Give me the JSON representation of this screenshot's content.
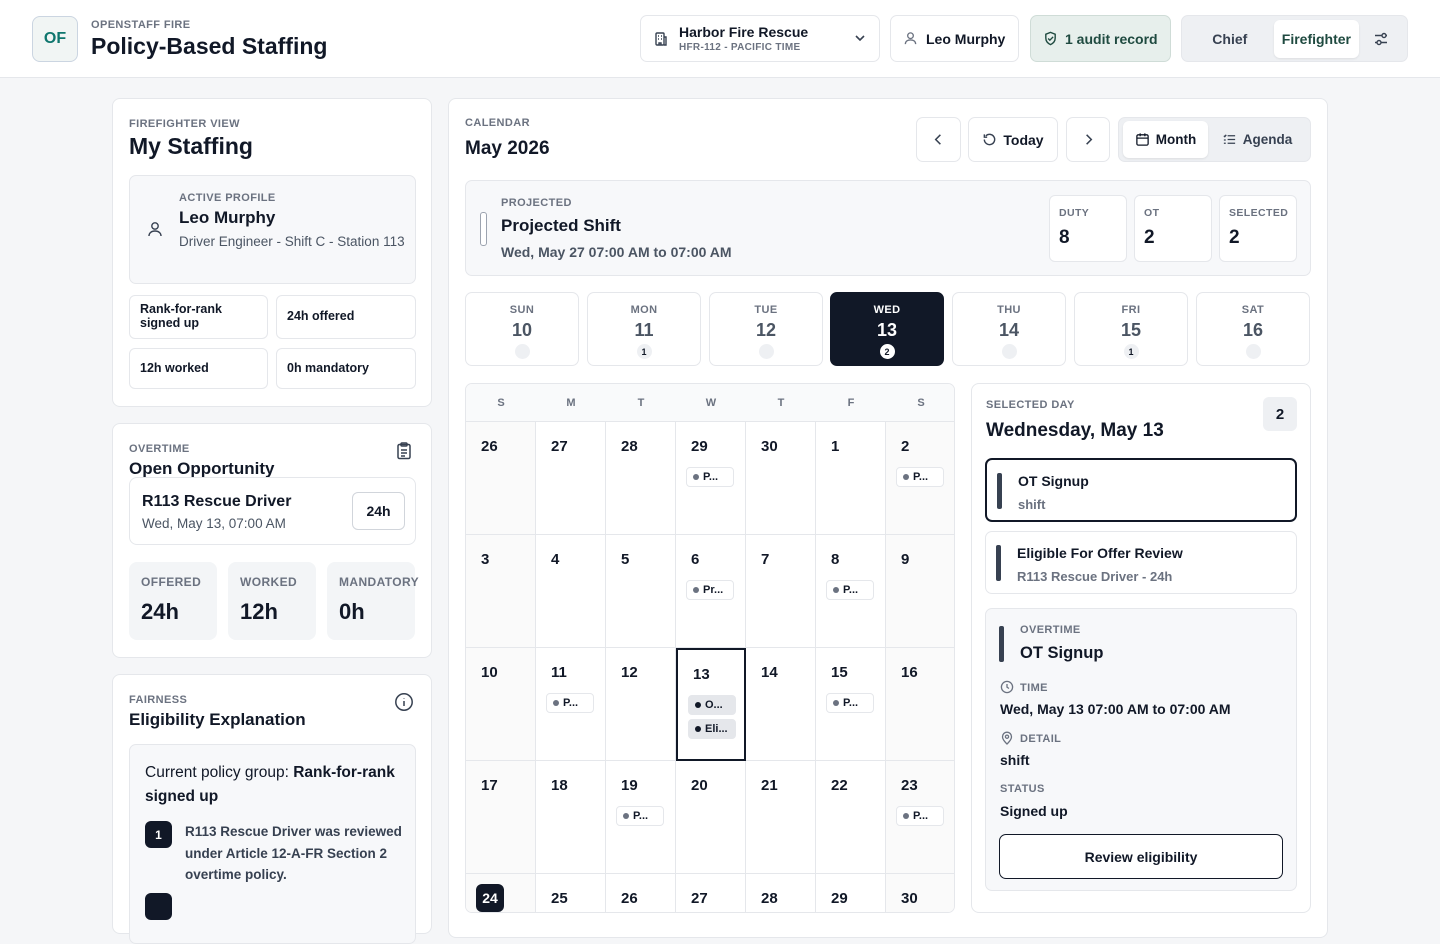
{
  "header": {
    "logo": "OF",
    "app_label": "OPENSTAFF FIRE",
    "title": "Policy-Based Staffing",
    "org": {
      "name": "Harbor Fire Rescue",
      "sub": "HFR-112 - PACIFIC TIME"
    },
    "user": "Leo Murphy",
    "audit": "1 audit record",
    "roles": [
      "Chief",
      "Firefighter"
    ],
    "active_role": "Firefighter"
  },
  "profile_card": {
    "label": "FIREFIGHTER VIEW",
    "title": "My Staffing",
    "active_label": "ACTIVE PROFILE",
    "name": "Leo Murphy",
    "detail": "Driver Engineer - Shift C - Station 113",
    "chips": [
      "Rank-for-rank signed up",
      "24h offered",
      "12h worked",
      "0h mandatory"
    ]
  },
  "overtime_card": {
    "label": "OVERTIME",
    "title": "Open Opportunity",
    "opp_title": "R113 Rescue Driver",
    "opp_time": "Wed, May 13, 07:00 AM",
    "opp_hours": "24h",
    "stats": [
      {
        "k": "OFFERED",
        "v": "24h"
      },
      {
        "k": "WORKED",
        "v": "12h"
      },
      {
        "k": "MANDATORY",
        "v": "0h"
      }
    ]
  },
  "fairness_card": {
    "label": "FAIRNESS",
    "title": "Eligibility Explanation",
    "policy_prefix": "Current policy group: ",
    "policy_group": "Rank-for-rank signed up",
    "steps": [
      {
        "n": "1",
        "text": "R113 Rescue Driver was reviewed under Article 12-A-FR Section 2 overtime policy."
      }
    ]
  },
  "calendar": {
    "label": "CALENDAR",
    "month": "May 2026",
    "today_label": "Today",
    "views": [
      "Month",
      "Agenda"
    ],
    "projected": {
      "label": "PROJECTED",
      "title": "Projected Shift",
      "time": "Wed, May 27 07:00 AM to 07:00 AM",
      "stats": [
        {
          "k": "DUTY",
          "v": "8"
        },
        {
          "k": "OT",
          "v": "2"
        },
        {
          "k": "SELECTED",
          "v": "2"
        }
      ]
    },
    "week": [
      {
        "d": "SUN",
        "n": "10",
        "c": ""
      },
      {
        "d": "MON",
        "n": "11",
        "c": "1"
      },
      {
        "d": "TUE",
        "n": "12",
        "c": ""
      },
      {
        "d": "WED",
        "n": "13",
        "c": "2"
      },
      {
        "d": "THU",
        "n": "14",
        "c": ""
      },
      {
        "d": "FRI",
        "n": "15",
        "c": "1"
      },
      {
        "d": "SAT",
        "n": "16",
        "c": ""
      }
    ],
    "weekday_heads": [
      "S",
      "M",
      "T",
      "W",
      "T",
      "F",
      "S"
    ],
    "days": [
      "26",
      "27",
      "28",
      "29",
      "30",
      "1",
      "2",
      "3",
      "4",
      "5",
      "6",
      "7",
      "8",
      "9",
      "10",
      "11",
      "12",
      "13",
      "14",
      "15",
      "16",
      "17",
      "18",
      "19",
      "20",
      "21",
      "22",
      "23",
      "24",
      "25",
      "26",
      "27",
      "28",
      "29",
      "30"
    ],
    "events": {
      "3": [
        "P..."
      ],
      "6": [
        "P..."
      ],
      "10": [
        "Pr..."
      ],
      "12": [
        "P..."
      ],
      "15": [
        "P..."
      ],
      "17": [
        "O...",
        "Eli..."
      ],
      "19": [
        "P..."
      ],
      "23": [
        "P..."
      ],
      "27": [
        "P..."
      ]
    }
  },
  "selected_day": {
    "label": "SELECTED DAY",
    "title": "Wednesday, May 13",
    "count": "2",
    "events": [
      {
        "title": "OT Signup",
        "sub": "shift"
      },
      {
        "title": "Eligible For Offer Review",
        "sub": "R113 Rescue Driver - 24h"
      }
    ],
    "detail": {
      "label": "OVERTIME",
      "title": "OT Signup",
      "time_label": "TIME",
      "time": "Wed, May 13 07:00 AM to 07:00 AM",
      "detail_label": "DETAIL",
      "detail": "shift",
      "status_label": "STATUS",
      "status": "Signed up",
      "button": "Review eligibility"
    }
  }
}
